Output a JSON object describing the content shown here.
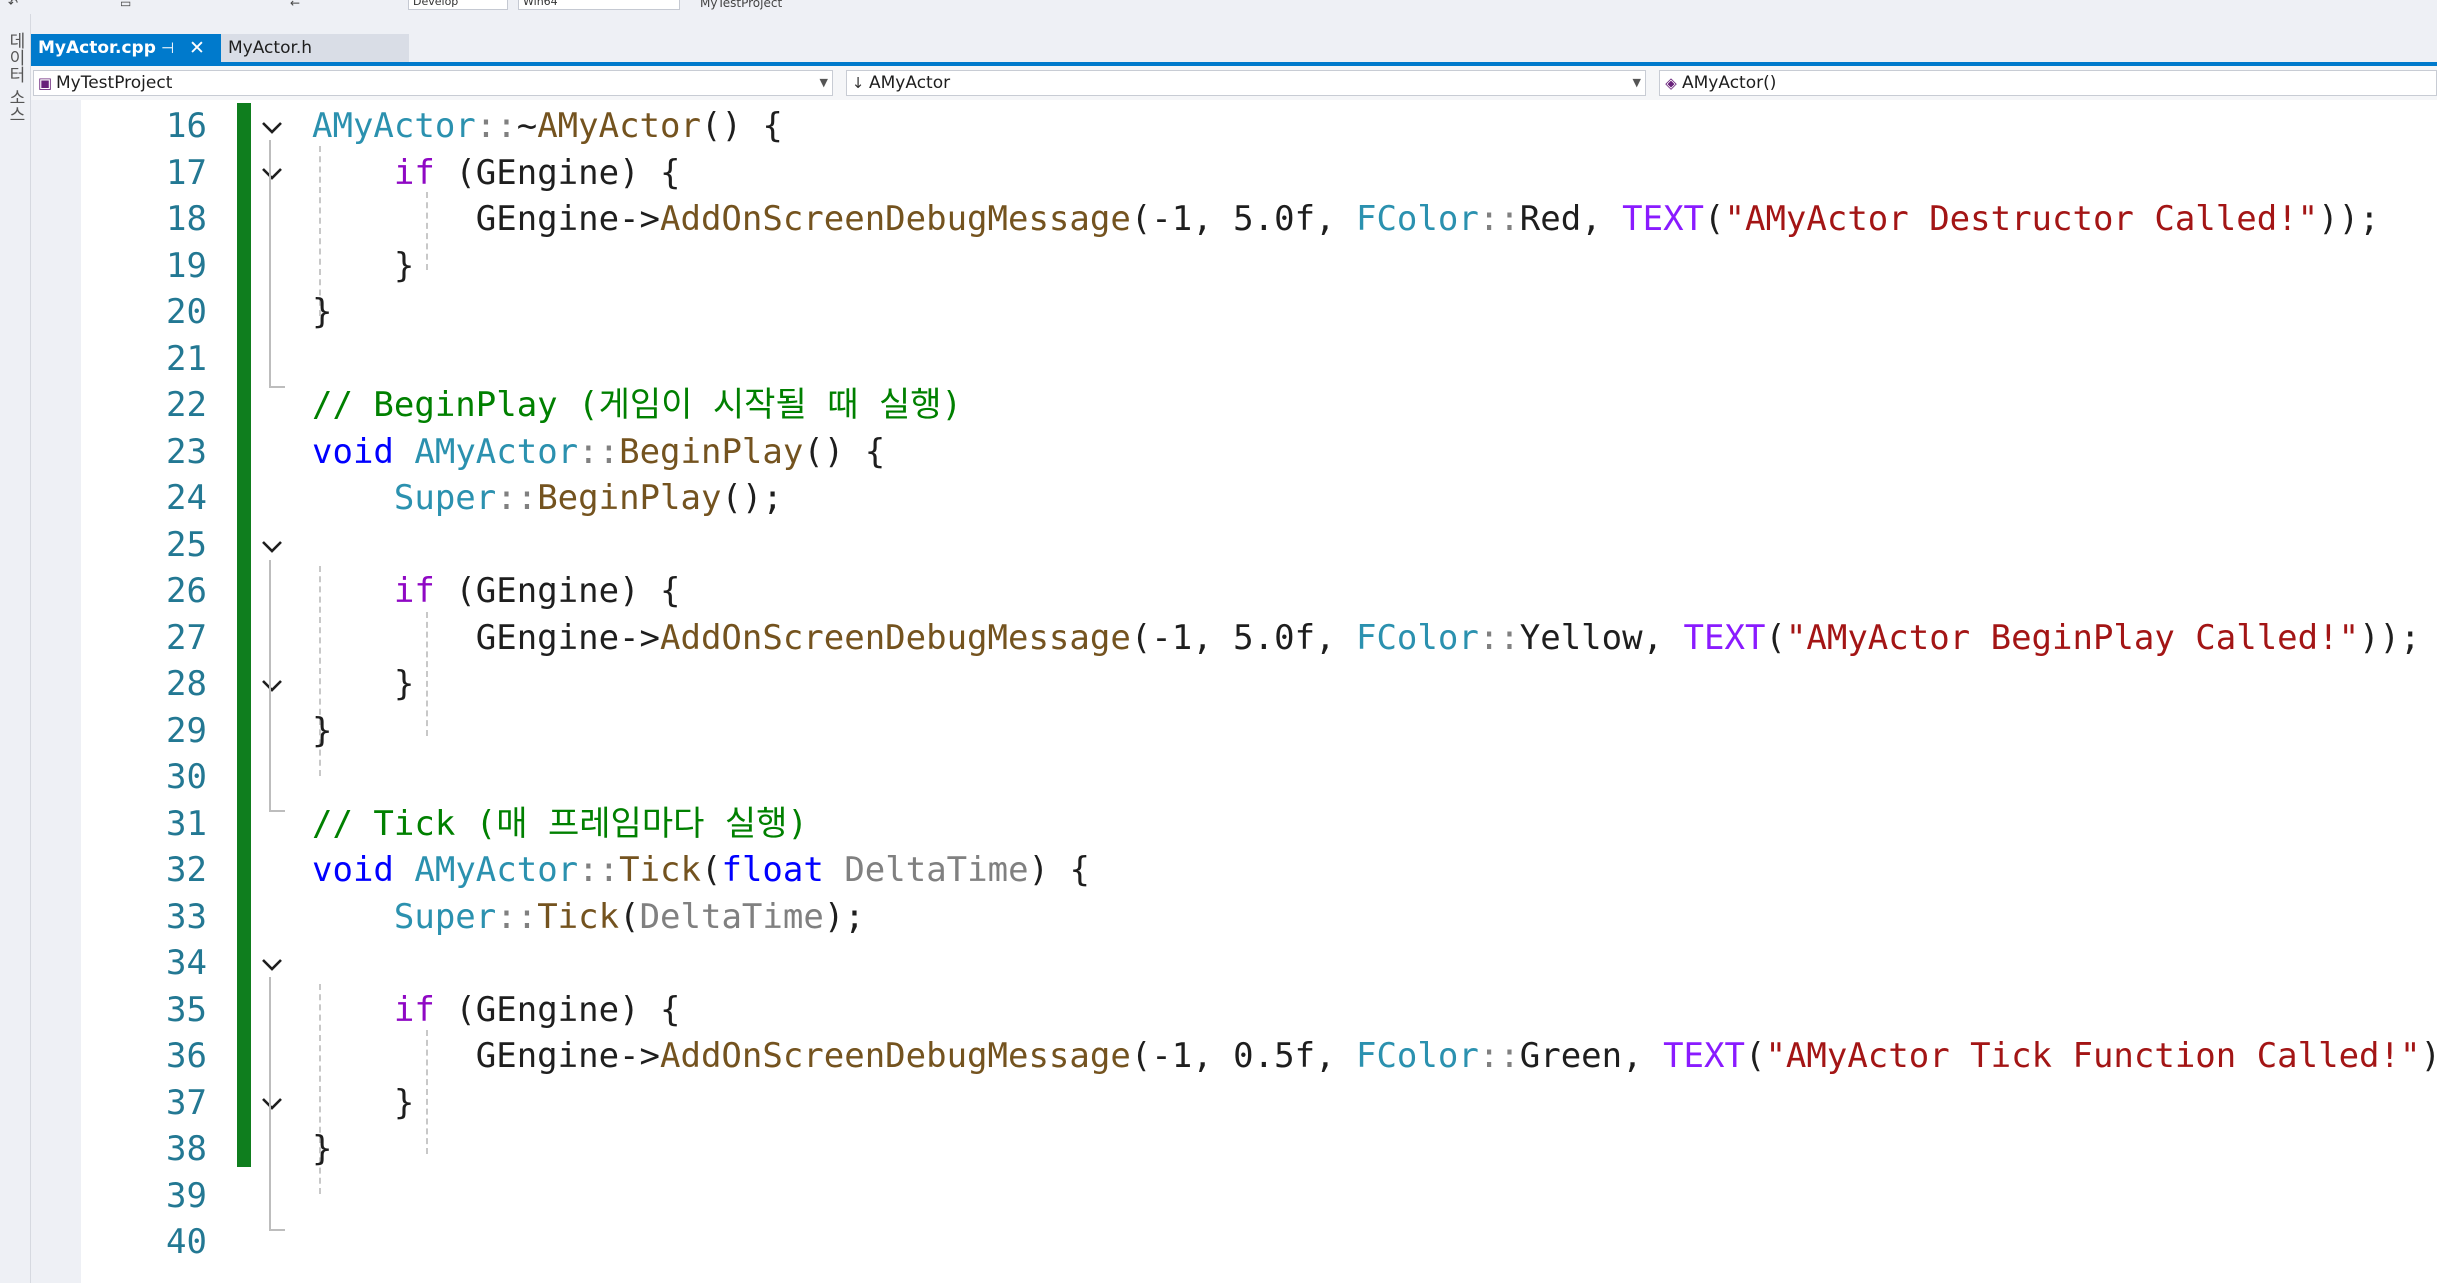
{
  "toolbar": {
    "config": "Develop",
    "platform": "Win64",
    "project_label": "MyTestProject"
  },
  "left_panel": {
    "vertical_label": "데이터 소스"
  },
  "tabs": [
    {
      "label": "MyActor.cpp",
      "active": true
    },
    {
      "label": "MyActor.h",
      "active": false
    }
  ],
  "navbar": {
    "project": "MyTestProject",
    "scope": "AMyActor",
    "member": "AMyActor()"
  },
  "editor": {
    "lines": [
      {
        "num": "16",
        "tokens": [
          [
            "ty",
            "AMyActor"
          ],
          [
            "pm",
            "::"
          ],
          [
            "dk",
            "~"
          ],
          [
            "fn",
            "AMyActor"
          ],
          [
            "dk",
            "() {"
          ]
        ]
      },
      {
        "num": "17",
        "tokens": [
          [
            "dk",
            "    "
          ],
          [
            "kwc",
            "if"
          ],
          [
            "dk",
            " (GEngine) {"
          ]
        ]
      },
      {
        "num": "18",
        "tokens": [
          [
            "dk",
            "        GEngine->"
          ],
          [
            "fn",
            "AddOnScreenDebugMessage"
          ],
          [
            "dk",
            "(-1, 5.0f, "
          ],
          [
            "ty",
            "FColor"
          ],
          [
            "pm",
            "::"
          ],
          [
            "dk",
            "Red, "
          ],
          [
            "mc",
            "TEXT"
          ],
          [
            "dk",
            "("
          ],
          [
            "st",
            "\"AMyActor Destructor Called!\""
          ],
          [
            "dk",
            "));"
          ]
        ]
      },
      {
        "num": "19",
        "tokens": [
          [
            "dk",
            "    }"
          ]
        ]
      },
      {
        "num": "20",
        "tokens": [
          [
            "dk",
            "}"
          ]
        ]
      },
      {
        "num": "21",
        "tokens": []
      },
      {
        "num": "22",
        "tokens": [
          [
            "cm",
            "// BeginPlay (게임이 시작될 때 실행)"
          ]
        ]
      },
      {
        "num": "23",
        "tokens": [
          [
            "kw",
            "void"
          ],
          [
            "dk",
            " "
          ],
          [
            "ty",
            "AMyActor"
          ],
          [
            "pm",
            "::"
          ],
          [
            "fn",
            "BeginPlay"
          ],
          [
            "dk",
            "() {"
          ]
        ]
      },
      {
        "num": "24",
        "tokens": [
          [
            "dk",
            "    "
          ],
          [
            "ty",
            "Super"
          ],
          [
            "pm",
            "::"
          ],
          [
            "fn",
            "BeginPlay"
          ],
          [
            "dk",
            "();"
          ]
        ]
      },
      {
        "num": "25",
        "tokens": []
      },
      {
        "num": "26",
        "tokens": [
          [
            "dk",
            "    "
          ],
          [
            "kwc",
            "if"
          ],
          [
            "dk",
            " (GEngine) {"
          ]
        ]
      },
      {
        "num": "27",
        "tokens": [
          [
            "dk",
            "        GEngine->"
          ],
          [
            "fn",
            "AddOnScreenDebugMessage"
          ],
          [
            "dk",
            "(-1, 5.0f, "
          ],
          [
            "ty",
            "FColor"
          ],
          [
            "pm",
            "::"
          ],
          [
            "dk",
            "Yellow, "
          ],
          [
            "mc",
            "TEXT"
          ],
          [
            "dk",
            "("
          ],
          [
            "st",
            "\"AMyActor BeginPlay Called!\""
          ],
          [
            "dk",
            "));"
          ]
        ]
      },
      {
        "num": "28",
        "tokens": [
          [
            "dk",
            "    }"
          ]
        ]
      },
      {
        "num": "29",
        "tokens": [
          [
            "dk",
            "}"
          ]
        ]
      },
      {
        "num": "30",
        "tokens": []
      },
      {
        "num": "31",
        "tokens": [
          [
            "cm",
            "// Tick (매 프레임마다 실행)"
          ]
        ]
      },
      {
        "num": "32",
        "tokens": [
          [
            "kw",
            "void"
          ],
          [
            "dk",
            " "
          ],
          [
            "ty",
            "AMyActor"
          ],
          [
            "pm",
            "::"
          ],
          [
            "fn",
            "Tick"
          ],
          [
            "dk",
            "("
          ],
          [
            "kw",
            "float"
          ],
          [
            "dk",
            " "
          ],
          [
            "pm",
            "DeltaTime"
          ],
          [
            "dk",
            ") {"
          ]
        ]
      },
      {
        "num": "33",
        "tokens": [
          [
            "dk",
            "    "
          ],
          [
            "ty",
            "Super"
          ],
          [
            "pm",
            "::"
          ],
          [
            "fn",
            "Tick"
          ],
          [
            "dk",
            "("
          ],
          [
            "pm",
            "DeltaTime"
          ],
          [
            "dk",
            ");"
          ]
        ]
      },
      {
        "num": "34",
        "tokens": []
      },
      {
        "num": "35",
        "tokens": [
          [
            "dk",
            "    "
          ],
          [
            "kwc",
            "if"
          ],
          [
            "dk",
            " (GEngine) {"
          ]
        ]
      },
      {
        "num": "36",
        "tokens": [
          [
            "dk",
            "        GEngine->"
          ],
          [
            "fn",
            "AddOnScreenDebugMessage"
          ],
          [
            "dk",
            "(-1, 0.5f, "
          ],
          [
            "ty",
            "FColor"
          ],
          [
            "pm",
            "::"
          ],
          [
            "dk",
            "Green, "
          ],
          [
            "mc",
            "TEXT"
          ],
          [
            "dk",
            "("
          ],
          [
            "st",
            "\"AMyActor Tick Function Called!\""
          ],
          [
            "dk",
            "));"
          ]
        ]
      },
      {
        "num": "37",
        "tokens": [
          [
            "dk",
            "    }"
          ]
        ]
      },
      {
        "num": "38",
        "tokens": [
          [
            "dk",
            "}"
          ]
        ]
      },
      {
        "num": "39",
        "tokens": []
      },
      {
        "num": "40",
        "tokens": []
      }
    ]
  }
}
